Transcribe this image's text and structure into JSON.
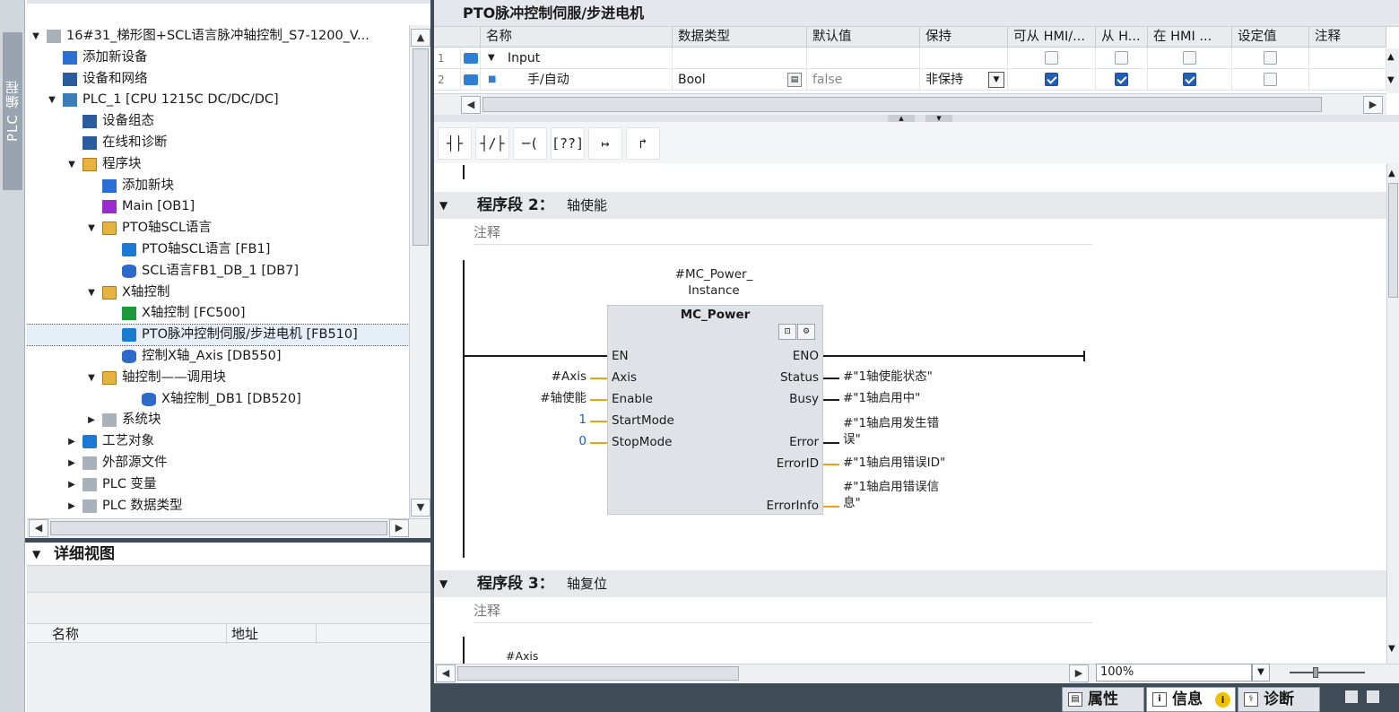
{
  "sidebar": {
    "label": "PLC 编程"
  },
  "tree": {
    "items": [
      {
        "label": "16#31_梯形图+SCL语言脉冲轴控制_S7-1200_V...",
        "toggle": "▼",
        "icon": "project-icon"
      },
      {
        "label": "添加新设备",
        "icon": "add-device-icon"
      },
      {
        "label": "设备和网络",
        "icon": "network-icon"
      },
      {
        "label": "PLC_1 [CPU 1215C DC/DC/DC]",
        "toggle": "▼",
        "icon": "plc-icon"
      },
      {
        "label": "设备组态",
        "icon": "device-config-icon"
      },
      {
        "label": "在线和诊断",
        "icon": "online-diag-icon"
      },
      {
        "label": "程序块",
        "toggle": "▼",
        "icon": "folder-icon"
      },
      {
        "label": "添加新块",
        "icon": "add-block-icon"
      },
      {
        "label": "Main [OB1]",
        "icon": "ob-icon"
      },
      {
        "label": "PTO轴SCL语言",
        "toggle": "▼",
        "icon": "folder-icon"
      },
      {
        "label": "PTO轴SCL语言 [FB1]",
        "icon": "fb-icon"
      },
      {
        "label": "SCL语言FB1_DB_1 [DB7]",
        "icon": "db-icon"
      },
      {
        "label": "X轴控制",
        "toggle": "▼",
        "icon": "folder-icon"
      },
      {
        "label": "X轴控制 [FC500]",
        "icon": "fc-icon"
      },
      {
        "label": "PTO脉冲控制伺服/步进电机 [FB510]",
        "icon": "fb-icon"
      },
      {
        "label": "控制X轴_Axis [DB550]",
        "icon": "db-icon"
      },
      {
        "label": "轴控制——调用块",
        "toggle": "▼",
        "icon": "folder-icon"
      },
      {
        "label": "X轴控制_DB1 [DB520]",
        "icon": "db-icon"
      },
      {
        "label": "系统块",
        "toggle": "▶",
        "icon": "system-block-icon"
      },
      {
        "label": "工艺对象",
        "toggle": "▶",
        "icon": "tech-object-icon"
      },
      {
        "label": "外部源文件",
        "toggle": "▶",
        "icon": "external-source-icon"
      },
      {
        "label": "PLC 变量",
        "toggle": "▶",
        "icon": "plc-tags-icon"
      },
      {
        "label": "PLC 数据类型",
        "toggle": "▶",
        "icon": "plc-datatype-icon"
      }
    ]
  },
  "detail": {
    "title": "详细视图",
    "col_name": "名称",
    "col_addr": "地址"
  },
  "editor": {
    "title": "PTO脉冲控制伺服/步进电机",
    "interface": {
      "headers": [
        "名称",
        "数据类型",
        "默认值",
        "保持",
        "可从 HMI/...",
        "从 H...",
        "在 HMI ...",
        "设定值",
        "注释"
      ],
      "rows": [
        {
          "num": "1",
          "name": "Input",
          "type": "",
          "default": "",
          "retain": "",
          "hmi1": false,
          "hmi2": false,
          "hmi3": false,
          "setpoint": false
        },
        {
          "num": "2",
          "name": "手/自动",
          "type": "Bool",
          "default": "false",
          "retain": "非保持",
          "hmi1": true,
          "hmi2": true,
          "hmi3": true,
          "setpoint": false
        }
      ]
    },
    "toolbar": [
      "┤├",
      "┤/├",
      "─( )─",
      "[??]",
      "↦",
      "↱"
    ],
    "segments": [
      {
        "title": "程序段 2：",
        "name": "轴使能",
        "comment": "注释"
      },
      {
        "title": "程序段 3：",
        "name": "轴复位",
        "comment": "注释"
      }
    ],
    "fb": {
      "instance_line1": "#MC_Power_",
      "instance_line2": "Instance",
      "name": "MC_Power",
      "in_pins": [
        "EN",
        "Axis",
        "Enable",
        "StartMode",
        "StopMode"
      ],
      "out_pins": [
        "ENO",
        "Status",
        "Busy",
        "Error",
        "ErrorID",
        "ErrorInfo"
      ],
      "in_params": {
        "axis": "#Axis",
        "enable": "#轴使能",
        "startmode": "1",
        "stopmode": "0"
      },
      "out_params": {
        "status": "#\"1轴使能状态\"",
        "busy": "#\"1轴启用中\"",
        "error_l1": "#\"1轴启用发生错",
        "error_l2": "误\"",
        "errorid": "#\"1轴启用错误ID\"",
        "errorinfo_l1": "#\"1轴启用错误信",
        "errorinfo_l2": "息\""
      }
    },
    "seg3_param": "#Axis",
    "zoom": "100%"
  },
  "statusbar": {
    "properties": "属性",
    "info": "信息",
    "diag": "诊断"
  },
  "colors": {
    "accent": "#1f5fb8",
    "dark": "#3f4b57",
    "wire_orange": "#f0a312"
  }
}
